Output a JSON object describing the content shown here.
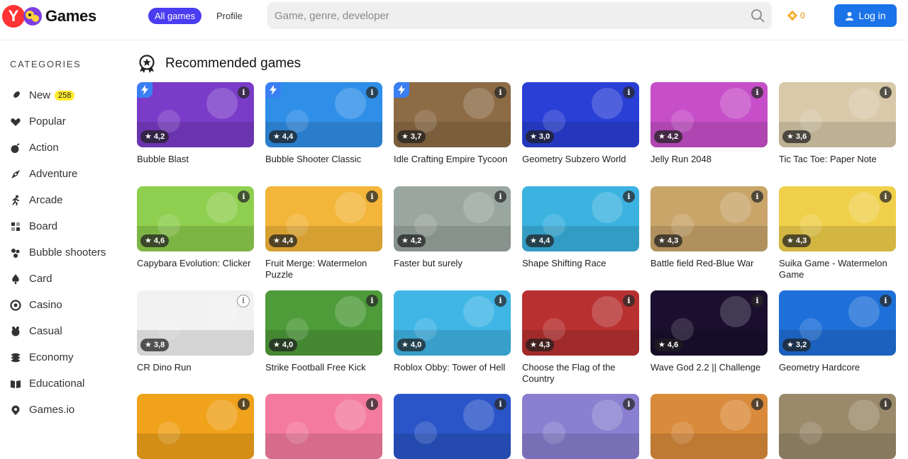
{
  "header": {
    "logo_text": "Games",
    "nav_all": "All games",
    "nav_profile": "Profile",
    "search_placeholder": "Game, genre, developer",
    "coins": "0",
    "login_label": "Log in"
  },
  "sidebar": {
    "title": "CATEGORIES",
    "items": [
      {
        "label": "New",
        "badge": "258",
        "icon": "rocket-icon"
      },
      {
        "label": "Popular",
        "icon": "heart-icon"
      },
      {
        "label": "Action",
        "icon": "bomb-icon"
      },
      {
        "label": "Adventure",
        "icon": "compass-icon"
      },
      {
        "label": "Arcade",
        "icon": "runner-icon"
      },
      {
        "label": "Board",
        "icon": "board-icon"
      },
      {
        "label": "Bubble shooters",
        "icon": "bubbles-icon"
      },
      {
        "label": "Card",
        "icon": "spade-icon"
      },
      {
        "label": "Casino",
        "icon": "chip-icon"
      },
      {
        "label": "Casual",
        "icon": "casual-icon"
      },
      {
        "label": "Economy",
        "icon": "coins-icon"
      },
      {
        "label": "Educational",
        "icon": "book-icon"
      },
      {
        "label": "Games.io",
        "icon": "pin-icon"
      }
    ]
  },
  "main": {
    "section_title": "Recommended games",
    "games": [
      {
        "name": "Bubble Blast",
        "rating": "★ 4,2",
        "new": true,
        "bg": "#7a3cc8"
      },
      {
        "name": "Bubble Shooter Classic",
        "rating": "★ 4,4",
        "new": true,
        "bg": "#2f8fe8"
      },
      {
        "name": "Idle Crafting Empire Tycoon",
        "rating": "★ 3,7",
        "new": true,
        "bg": "#8c6b45"
      },
      {
        "name": "Geometry Subzero World",
        "rating": "★ 3,0",
        "bg": "#2a3fd6"
      },
      {
        "name": "Jelly Run 2048",
        "rating": "★ 4,2",
        "bg": "#c64fc9"
      },
      {
        "name": "Tic Tac Toe: Paper Note",
        "rating": "★ 3,6",
        "bg": "#d8c9a9"
      },
      {
        "name": "Capybara Evolution: Clicker",
        "rating": "★ 4,6",
        "bg": "#8fcf4f"
      },
      {
        "name": "Fruit Merge: Watermelon Puzzle",
        "rating": "★ 4,4",
        "bg": "#f3b63a"
      },
      {
        "name": "Faster but surely",
        "rating": "★ 4,2",
        "bg": "#9aa7a0"
      },
      {
        "name": "Shape Shifting Race",
        "rating": "★ 4,4",
        "bg": "#3bb2e0"
      },
      {
        "name": "Battle field Red-Blue War",
        "rating": "★ 4,3",
        "bg": "#c9a56a"
      },
      {
        "name": "Suika Game - Watermelon Game",
        "rating": "★ 4,3",
        "bg": "#f0d04a"
      },
      {
        "name": "CR Dino Run",
        "rating": "★ 3,8",
        "bg": "#f2f2f2"
      },
      {
        "name": "Strike Football Free Kick",
        "rating": "★ 4,0",
        "bg": "#4e9b3a"
      },
      {
        "name": "Roblox Obby: Tower of Hell",
        "rating": "★ 4,0",
        "bg": "#3fb6e6"
      },
      {
        "name": "Choose the Flag of the Country",
        "rating": "★ 4,3",
        "bg": "#b83030"
      },
      {
        "name": "Wave God 2.2 || Challenge",
        "rating": "★ 4,6",
        "bg": "#1a0f2e"
      },
      {
        "name": "Geometry Hardcore",
        "rating": "★ 3,2",
        "bg": "#1f6fd8"
      },
      {
        "name": "",
        "rating": "",
        "bg": "#f0a21a"
      },
      {
        "name": "",
        "rating": "",
        "bg": "#f47aa0"
      },
      {
        "name": "",
        "rating": "",
        "bg": "#2a55c8"
      },
      {
        "name": "",
        "rating": "",
        "bg": "#8a7fd0"
      },
      {
        "name": "",
        "rating": "",
        "bg": "#d98a3a"
      },
      {
        "name": "",
        "rating": "",
        "bg": "#9a8a6a"
      }
    ]
  }
}
